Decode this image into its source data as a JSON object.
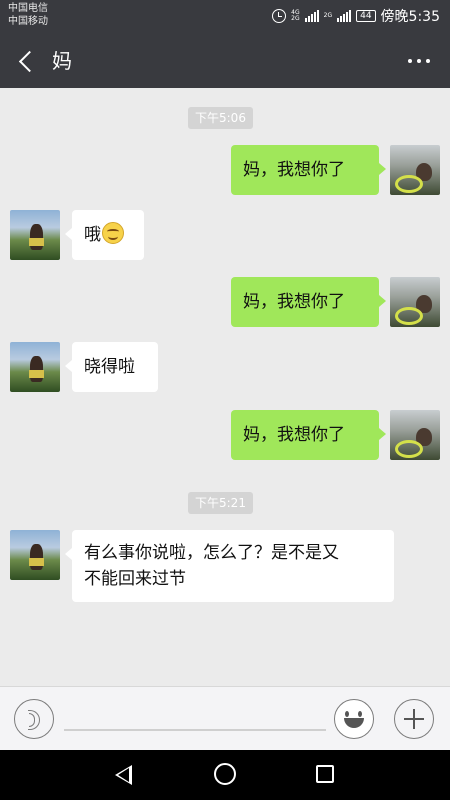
{
  "status_bar": {
    "carrier_1": "中国电信",
    "carrier_2": "中国移动",
    "net_1a": "4G",
    "net_1b": "2G",
    "net_2a": "2G",
    "battery": "44",
    "time": "傍晚5:35"
  },
  "header": {
    "title": "妈",
    "back_icon": "back-arrow-icon",
    "more_icon": "more-dots-icon"
  },
  "messages": {
    "ts_1": "下午5:06",
    "m1": "妈，我想你了",
    "m2_text": "哦",
    "m2_emoji": "smile-emoji",
    "m3": "妈，我想你了",
    "m4": "晓得啦",
    "m5": "妈，我想你了",
    "ts_2": "下午5:21",
    "m6_line1": "有么事你说啦，怎么了？是不是又",
    "m6_line2": "不能回来过节"
  },
  "input_bar": {
    "voice_icon": "voice-icon",
    "emoji_icon": "emoji-icon",
    "plus_icon": "plus-icon"
  },
  "colors": {
    "header_bg": "#393a3f",
    "chat_bg": "#ebebeb",
    "out_bubble": "#a0e75a",
    "in_bubble": "#ffffff",
    "timestamp_bg": "#d4d4d4"
  }
}
